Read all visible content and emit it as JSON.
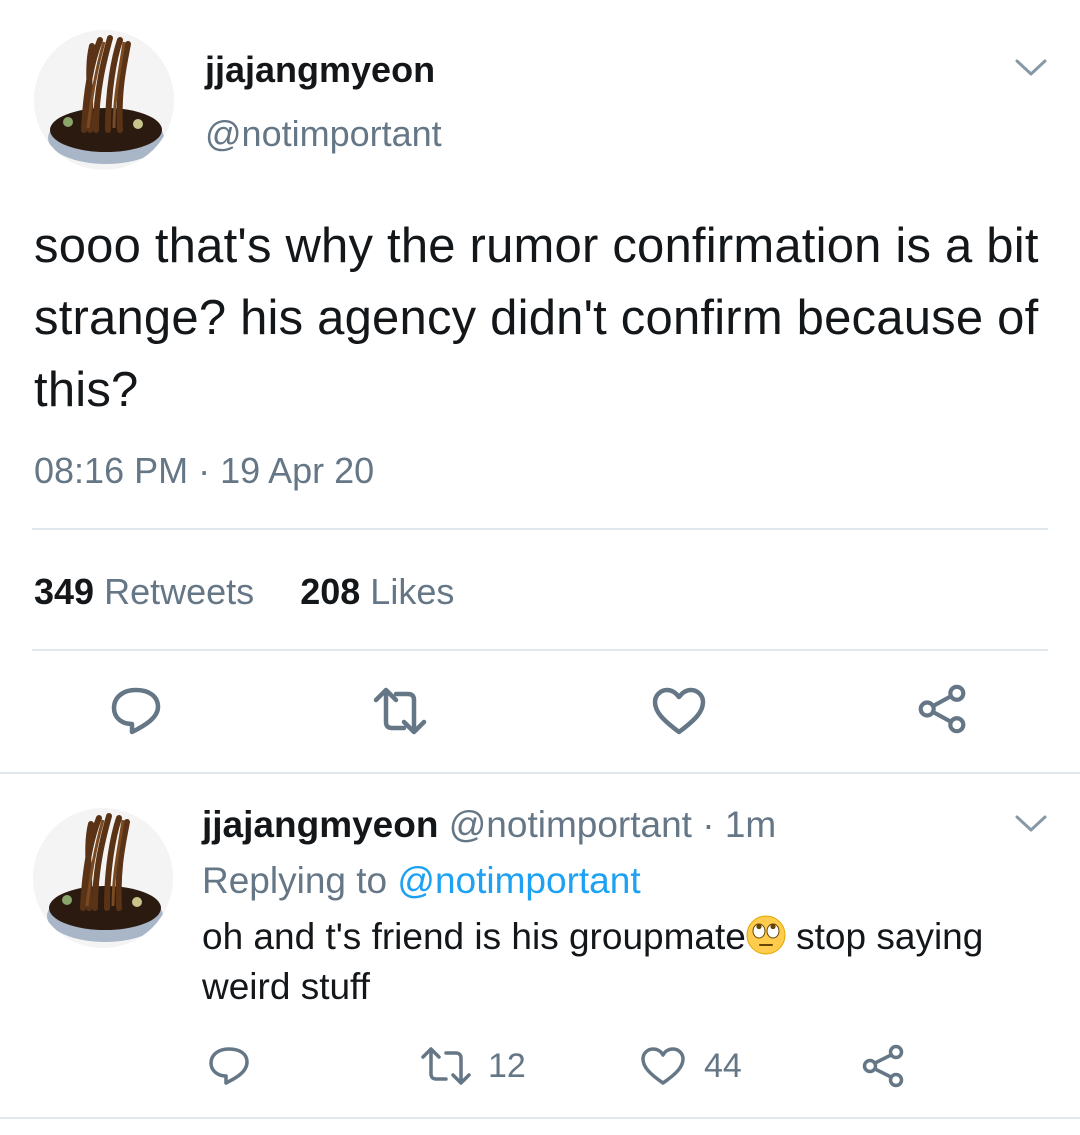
{
  "main_tweet": {
    "display_name": "jjajangmyeon",
    "handle": "@notimportant",
    "text": "sooo that's why the rumor confirmation is a bit strange? his agency didn't confirm because of this?",
    "timestamp": "08:16 PM · 19 Apr 20",
    "retweets_count": "349",
    "retweets_label": "Retweets",
    "likes_count": "208",
    "likes_label": "Likes",
    "icons": [
      "reply-icon",
      "retweet-icon",
      "like-icon",
      "share-icon",
      "chevron-down-icon"
    ]
  },
  "reply_tweet": {
    "display_name": "jjajangmyeon",
    "meta": "@notimportant · 1m",
    "replying_prefix": "Replying to",
    "replying_handle": "@notimportant",
    "text_before_emoji": "oh and t's friend is his groupmate",
    "emoji": "face-with-rolling-eyes",
    "text_after_emoji": " stop saying weird stuff",
    "retweets_count": "12",
    "likes_count": "44"
  },
  "colors": {
    "text_primary": "#14171a",
    "text_secondary": "#657786",
    "link": "#1da1f2",
    "divider": "#e1e8ed"
  }
}
